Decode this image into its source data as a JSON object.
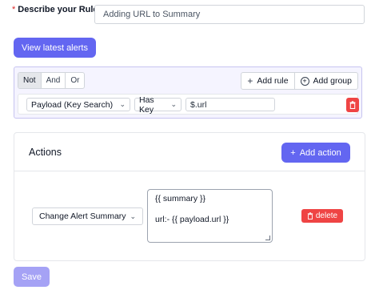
{
  "rule": {
    "required_mark": "*",
    "label": "Describe your Rule :",
    "value": "Adding URL to Summary"
  },
  "view_alerts_label": "View latest alerts",
  "query_builder": {
    "combinators": [
      "Not",
      "And",
      "Or"
    ],
    "active_combinator": "Not",
    "add_rule_label": "Add rule",
    "add_group_label": "Add group",
    "rule": {
      "field": "Payload (Key Search)",
      "operator": "Has Key",
      "value": "$.url"
    }
  },
  "actions": {
    "title": "Actions",
    "add_action_label": "Add action",
    "items": [
      {
        "type": "Change Alert Summary",
        "line1": "{{ summary }}",
        "line2": "",
        "line3": "url:- {{ payload.url }}",
        "delete_label": "delete"
      }
    ]
  },
  "save_label": "Save",
  "colors": {
    "primary": "#6366f1",
    "danger": "#ef4444",
    "query_bg": "#f5f4ff"
  }
}
